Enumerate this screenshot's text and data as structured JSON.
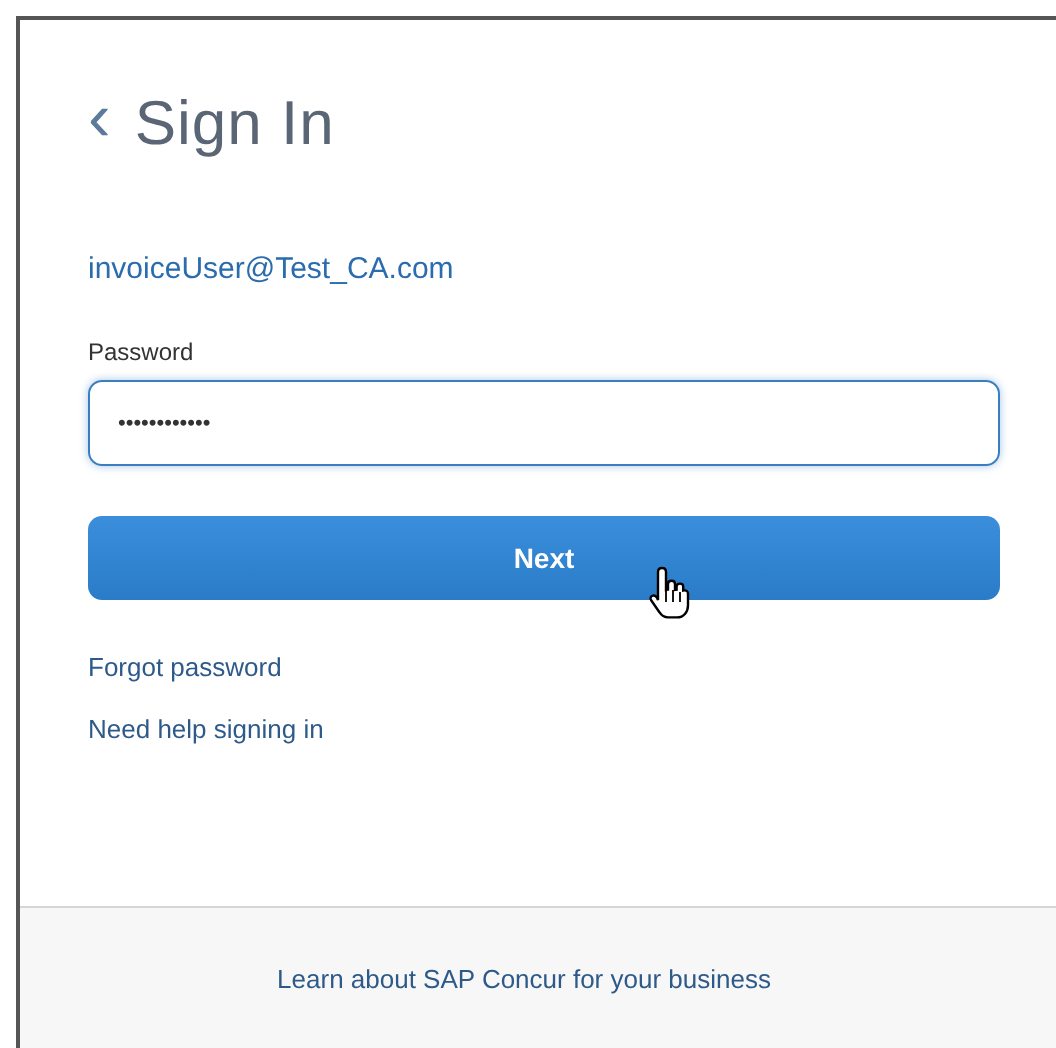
{
  "header": {
    "back_icon": "‹",
    "title": "Sign In"
  },
  "account": {
    "email": "invoiceUser@Test_CA.com"
  },
  "password": {
    "label": "Password",
    "value": "••••••••••••",
    "focused": true
  },
  "next_button": {
    "label": "Next",
    "hovered": true
  },
  "links": [
    {
      "label": "Forgot password"
    },
    {
      "label": "Need help signing in"
    }
  ],
  "footer": {
    "link": "Learn about SAP Concur for your business"
  }
}
